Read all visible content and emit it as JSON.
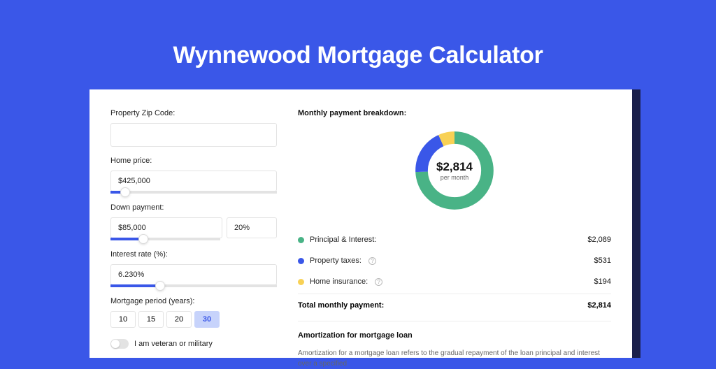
{
  "page_title": "Wynnewood Mortgage Calculator",
  "form": {
    "zip": {
      "label": "Property Zip Code:",
      "value": ""
    },
    "home_price": {
      "label": "Home price:",
      "value": "$425,000",
      "slider_pct": 9
    },
    "down_payment": {
      "label": "Down payment:",
      "amount": "$85,000",
      "percent": "20%",
      "slider_pct": 20
    },
    "interest_rate": {
      "label": "Interest rate (%):",
      "value": "6.230%",
      "slider_pct": 30
    },
    "mortgage_period": {
      "label": "Mortgage period (years):",
      "options": [
        "10",
        "15",
        "20",
        "30"
      ],
      "active": "30"
    },
    "veteran": {
      "label": "I am veteran or military",
      "checked": false
    }
  },
  "breakdown": {
    "title": "Monthly payment breakdown:",
    "center_amount": "$2,814",
    "center_sub": "per month",
    "items": [
      {
        "label": "Principal & Interest:",
        "value": "$2,089",
        "color": "green",
        "info": false
      },
      {
        "label": "Property taxes:",
        "value": "$531",
        "color": "blue",
        "info": true
      },
      {
        "label": "Home insurance:",
        "value": "$194",
        "color": "yellow",
        "info": true
      }
    ],
    "total_label": "Total monthly payment:",
    "total_value": "$2,814"
  },
  "amortization": {
    "title": "Amortization for mortgage loan",
    "text": "Amortization for a mortgage loan refers to the gradual repayment of the loan principal and interest over a specified"
  },
  "chart_data": {
    "type": "pie",
    "title": "Monthly payment breakdown",
    "series": [
      {
        "name": "Principal & Interest",
        "value": 2089,
        "color": "#49b386"
      },
      {
        "name": "Property taxes",
        "value": 531,
        "color": "#3a57e8"
      },
      {
        "name": "Home insurance",
        "value": 194,
        "color": "#f8d155"
      }
    ],
    "total": 2814,
    "center_label": "$2,814 per month"
  }
}
